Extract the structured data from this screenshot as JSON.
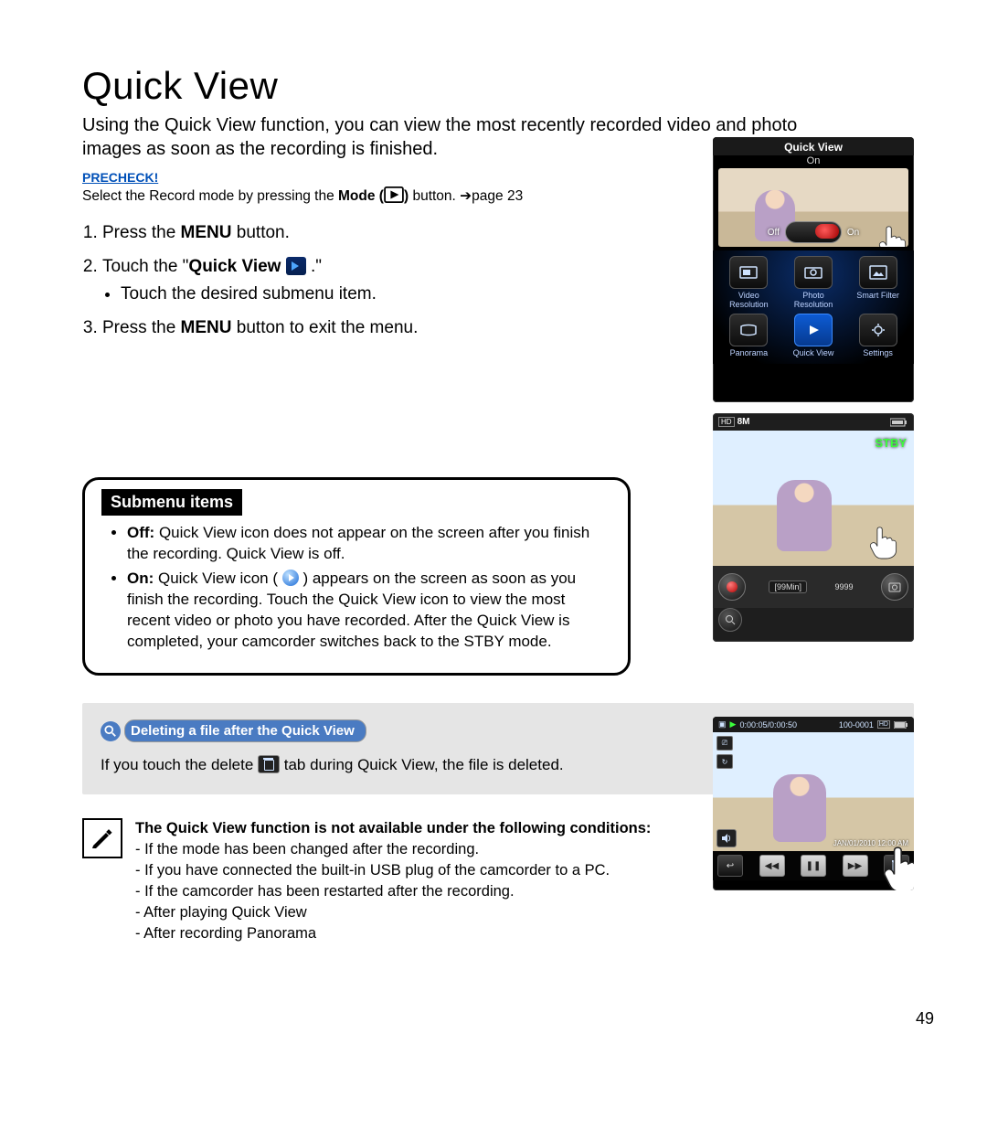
{
  "title": "Quick View",
  "intro": "Using the Quick View function, you can view the most recently recorded video and photo images as soon as the recording is finished.",
  "precheck": {
    "label": "PRECHECK!",
    "pre": "Select the Record mode by pressing the ",
    "mode": "Mode",
    "post": " button. ",
    "page_ref": "➔page 23"
  },
  "steps": {
    "s1_pre": "Press the ",
    "s1_bold": "MENU",
    "s1_post": " button.",
    "s2_pre": "Touch the \"",
    "s2_bold": "Quick View",
    "s2_post": " .\"",
    "s2_bullet": "Touch the desired submenu item.",
    "s3_pre": "Press the ",
    "s3_bold": "MENU",
    "s3_post": " button to exit the menu."
  },
  "submenu": {
    "head": "Submenu items",
    "off_label": "Off:",
    "off_text": " Quick View icon does not appear on the screen after you finish the recording. Quick View is off.",
    "on_label": "On:",
    "on_text_pre": " Quick View icon ( ",
    "on_text_post": " ) appears on the screen as soon as you finish the recording. Touch the Quick View icon to view the most recent video or photo you have recorded. After the Quick View is completed, your camcorder switches back to the STBY mode."
  },
  "tip": {
    "head": "Deleting a file after the Quick View",
    "body_pre": "If you touch the delete ",
    "body_post": " tab during Quick View, the file is deleted."
  },
  "note": {
    "head": "The Quick View function is not available under the following conditions:",
    "items": [
      "- If the mode has been changed after the recording.",
      "- If you have connected the built-in USB plug of the camcorder to a PC.",
      "- If the camcorder has been restarted after the recording.",
      "- After playing Quick View",
      "- After recording Panorama"
    ]
  },
  "page_number": "49",
  "screen1": {
    "title": "Quick View",
    "state": "On",
    "off": "Off",
    "on": "On",
    "menu": [
      {
        "label": "Video Resolution"
      },
      {
        "label": "Photo Resolution"
      },
      {
        "label": "Smart Filter"
      },
      {
        "label": "Panorama"
      },
      {
        "label": "Quick View",
        "selected": true
      },
      {
        "label": "Settings"
      }
    ]
  },
  "screen2": {
    "res": "8M",
    "status": "STBY",
    "time_remaining": "[99Min]",
    "shots_remaining": "9999"
  },
  "screen3": {
    "time": "0:00:05/0:00:50",
    "file": "100-0001",
    "date": "JAN/01/2010  12:00 AM"
  }
}
